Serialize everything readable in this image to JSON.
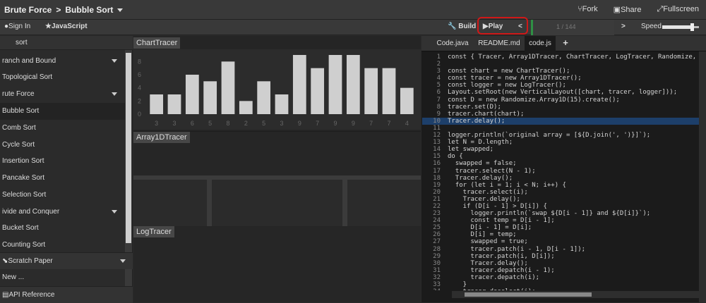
{
  "header": {
    "category": "Brute Force",
    "separator": ">",
    "algorithm": "Bubble Sort",
    "fork": "Fork",
    "share": "Share",
    "fullscreen": "Fullscreen"
  },
  "toolbar": {
    "sign_in": "Sign In",
    "language": "JavaScript",
    "build": "Build",
    "play": "Play",
    "prev": "<",
    "page": "1 / 144",
    "next": ">",
    "speed": "Speed",
    "speed_value": 0.8
  },
  "sidebar": {
    "search_value": "sort",
    "items": [
      {
        "label": "ranch and Bound",
        "expanded": true
      },
      {
        "label": "Topological Sort"
      },
      {
        "label": "rute Force",
        "expanded": true
      },
      {
        "label": "Bubble Sort"
      },
      {
        "label": "Comb Sort"
      },
      {
        "label": "Cycle Sort"
      },
      {
        "label": "Insertion Sort"
      },
      {
        "label": "Pancake Sort"
      },
      {
        "label": "Selection Sort"
      },
      {
        "label": "ivide and Conquer",
        "expanded": true
      },
      {
        "label": "Bucket Sort"
      },
      {
        "label": "Counting Sort"
      }
    ],
    "scratch": "Scratch Paper",
    "new": "New ...",
    "api": "API Reference"
  },
  "viz": {
    "chart_label": "ChartTracer",
    "array_label": "Array1DTracer",
    "log_label": "LogTracer"
  },
  "chart_data": {
    "type": "bar",
    "categories": [
      "3",
      "3",
      "6",
      "5",
      "8",
      "2",
      "5",
      "3",
      "9",
      "7",
      "9",
      "9",
      "7",
      "7",
      "4"
    ],
    "values": [
      3,
      3,
      6,
      5,
      8,
      2,
      5,
      3,
      9,
      7,
      9,
      9,
      7,
      7,
      4
    ],
    "ylim": [
      0,
      9
    ],
    "ytick_labels": [
      "0",
      "2",
      "4",
      "6",
      "8"
    ],
    "colors": {
      "bar": "#cfcfcf",
      "background": "#2c2c2c"
    }
  },
  "editor": {
    "tabs": [
      "Code.java",
      "README.md",
      "code.js",
      "+"
    ],
    "active_tab": 2,
    "highlight_line": 10,
    "lines": [
      "const { Tracer, Array1DTracer, ChartTracer, LogTracer, Randomize, Layout,",
      "",
      "const chart = new ChartTracer();",
      "const tracer = new Array1DTracer();",
      "const logger = new LogTracer();",
      "Layout.setRoot(new VerticalLayout([chart, tracer, logger]));",
      "const D = new Randomize.Array1D(15).create();",
      "tracer.set(D);",
      "tracer.chart(chart);",
      "Tracer.delay();",
      "",
      "logger.println(`original array = [${D.join(', ')}]`);",
      "let N = D.length;",
      "let swapped;",
      "do {",
      "  swapped = false;",
      "  tracer.select(N - 1);",
      "  Tracer.delay();",
      "  for (let i = 1; i < N; i++) {",
      "    tracer.select(i);",
      "    Tracer.delay();",
      "    if (D[i - 1] > D[i]) {",
      "      logger.println(`swap ${D[i - 1]} and ${D[i]}`);",
      "      const temp = D[i - 1];",
      "      D[i - 1] = D[i];",
      "      D[i] = temp;",
      "      swapped = true;",
      "      tracer.patch(i - 1, D[i - 1]);",
      "      tracer.patch(i, D[i]);",
      "      Tracer.delay();",
      "      tracer.depatch(i - 1);",
      "      tracer.depatch(i);",
      "    }",
      "    tracer.deselect(i);"
    ]
  }
}
